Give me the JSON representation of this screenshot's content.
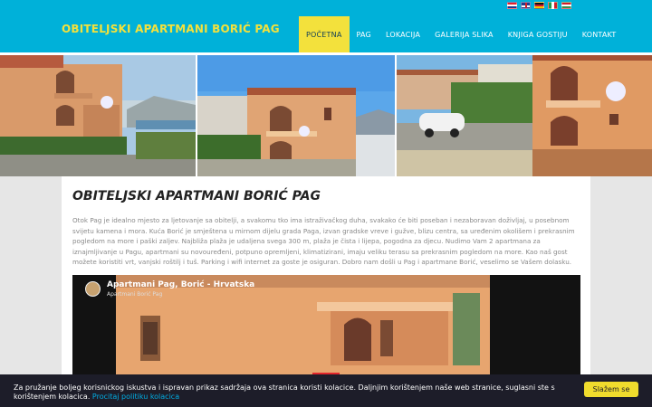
{
  "header": {
    "site_title": "OBITELJSKI APARTMANI BORIĆ PAG",
    "nav": [
      {
        "label": "POČETNA",
        "active": true
      },
      {
        "label": "PAG",
        "active": false
      },
      {
        "label": "LOKACIJA",
        "active": false
      },
      {
        "label": "GALERIJA SLIKA",
        "active": false
      },
      {
        "label": "KNJIGA GOSTIJU",
        "active": false
      },
      {
        "label": "KONTAKT",
        "active": false
      }
    ],
    "flags": [
      "croatian-flag-icon",
      "english-flag-icon",
      "german-flag-icon",
      "italian-flag-icon",
      "hungarian-flag-icon"
    ]
  },
  "main": {
    "title": "OBITELJSKI APARTMANI BORIĆ PAG",
    "paragraph": "Otok Pag je idealno mjesto za ljetovanje sa obitelji, a svakomu tko ima istraživačkog duha, svakako će biti poseban i nezaboravan doživljaj, u posebnom svijetu kamena i mora. Kuća Borić je smještena u mirnom dijelu grada Paga, izvan gradske vreve i gužve, blizu centra, sa uređenim okolišem i prekrasnim pogledom na more i paški zaljev. Najbliža plaža je udaljena svega 300 m, plaža je čista i lijepa, pogodna za djecu. Nudimo Vam 2 apartmana za iznajmljivanje u Pagu, apartmani su novouređeni, potpuno opremljeni, klimatizirani, imaju veliku terasu sa prekrasnim pogledom na more. Kao naš gost možete koristiti vrt, vanjski roštilj i tuš. Parking i wifi internet za goste je osiguran. Dobro nam došli u Pag i apartmane Borić, veselimo se Vašem dolasku."
  },
  "video": {
    "title": "Apartmani Pag, Borić - Hrvatska",
    "channel": "Apartmani Borić Pag"
  },
  "cookie": {
    "text": "Za pružanje boljeg korisnickog iskustva i ispravan prikaz sadržaja ova stranica koristi kolacice. Daljnjim korištenjem naše web stranice, suglasni ste s korištenjem kolacica.",
    "link": "Procitaj politiku kolacica",
    "button": "Slažem se"
  },
  "colors": {
    "header_bg": "#00b1d9",
    "accent_yellow": "#f3e13c",
    "cookie_bg": "#1d1d29"
  }
}
